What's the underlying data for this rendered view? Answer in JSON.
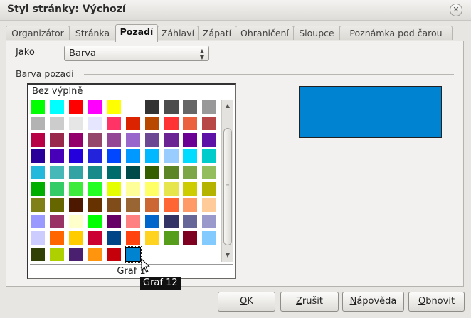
{
  "window": {
    "title": "Styl stránky: Výchozí"
  },
  "tabs": [
    {
      "label": "Organizátor"
    },
    {
      "label": "Stránka"
    },
    {
      "label": "Pozadí"
    },
    {
      "label": "Záhlaví"
    },
    {
      "label": "Zápatí"
    },
    {
      "label": "Ohraničení"
    },
    {
      "label": "Sloupce"
    },
    {
      "label": "Poznámka pod čarou"
    }
  ],
  "active_tab": "Pozadí",
  "jako": {
    "label_mnemonic": "J",
    "label_rest": "ako",
    "value": "Barva"
  },
  "background_group": {
    "label": "Barva pozadí"
  },
  "color_set": {
    "none_label": "Bez výplně",
    "hover_name": "Graf 1",
    "tooltip": "Graf 12",
    "rows": [
      [
        "#00ff00",
        "#00ffff",
        "#ff0000",
        "#ff00ff",
        "#ffff00",
        "#ffffff",
        "#333333",
        "#4d4d4d",
        "#666666",
        "#999999"
      ],
      [
        "#b3b3b3",
        "#cccccc",
        "#e6e6e6",
        "#e6e6ff",
        "#ff3366",
        "#dc2300",
        "#b84700",
        "#ff3333",
        "#eb613d",
        "#b84747"
      ],
      [
        "#b80047",
        "#99284d",
        "#94006b",
        "#94476b",
        "#944794",
        "#9966cc",
        "#6b4794",
        "#6b2394",
        "#6b0094",
        "#5e11a6"
      ],
      [
        "#280099",
        "#4700b8",
        "#2300dc",
        "#2323dc",
        "#0047ff",
        "#0099ff",
        "#00b8ff",
        "#99ccff",
        "#00dcff",
        "#00cccc"
      ],
      [
        "#23b8dc",
        "#47b8b8",
        "#33a3a3",
        "#198a8a",
        "#006b6b",
        "#004a4a",
        "#355e00",
        "#5c8526",
        "#7da647",
        "#94bd5e"
      ],
      [
        "#00ae00",
        "#33cc66",
        "#3deb3d",
        "#23ff23",
        "#e6ff00",
        "#ffff99",
        "#ffff66",
        "#e6e64c",
        "#cccc00",
        "#b3b300"
      ],
      [
        "#808019",
        "#666600",
        "#4c1900",
        "#663300",
        "#804c19",
        "#996633",
        "#cc6633",
        "#ff6633",
        "#ff9966",
        "#ffcc99"
      ],
      [
        "#9999ff",
        "#993366",
        "#ffffcc",
        "#00ff00",
        "#660066",
        "#ff8080",
        "#0066cc",
        "#333366",
        "#666699",
        "#9999cc"
      ],
      [
        "#ccccff",
        "#ff6600",
        "#ffcc00",
        "#cc0033",
        "#004586",
        "#ff420e",
        "#ffd320",
        "#579d1c",
        "#7e0021",
        "#83caff"
      ],
      [
        "#314004",
        "#aecf00",
        "#4b1f6f",
        "#ff950e",
        "#c5000b",
        "#0084d1"
      ]
    ],
    "selected_color": "#0084d1",
    "scrollbar": {
      "thumb_label": "≡"
    }
  },
  "preview": {
    "color": "#0084d1"
  },
  "buttons": {
    "ok": {
      "mnemonic": "O",
      "rest": "K"
    },
    "cancel": {
      "mnemonic": "Z",
      "rest": "rušit"
    },
    "help": {
      "mnemonic": "N",
      "rest": "ápověda"
    },
    "reset": {
      "mnemonic": "O",
      "rest": "bnovit"
    }
  },
  "colors": {
    "dialog_bg": "#e8e6e2",
    "tooltip_bg": "#111111"
  }
}
